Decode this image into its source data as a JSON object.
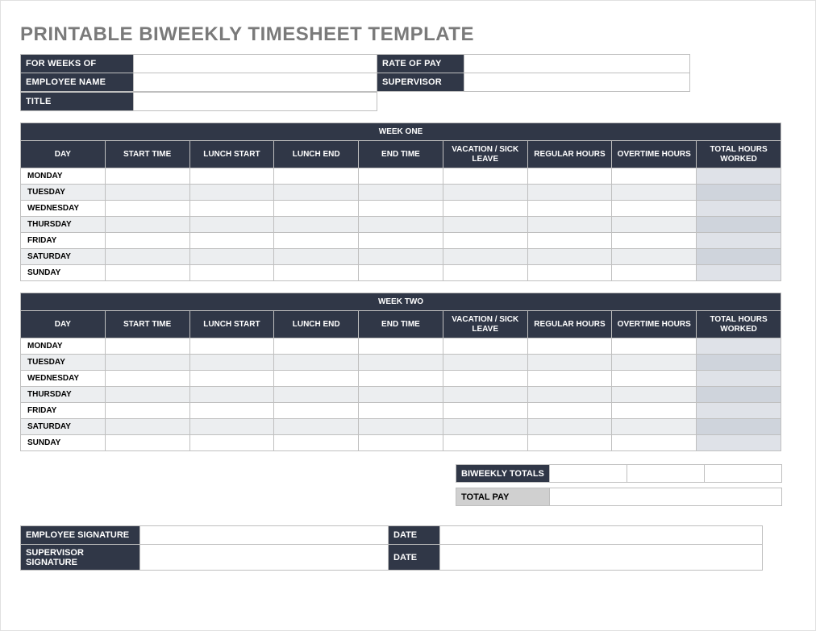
{
  "title": "PRINTABLE BIWEEKLY TIMESHEET TEMPLATE",
  "info": {
    "for_weeks_of_label": "FOR WEEKS OF",
    "for_weeks_of_value": "",
    "rate_of_pay_label": "RATE OF PAY",
    "rate_of_pay_value": "",
    "employee_name_label": "EMPLOYEE NAME",
    "employee_name_value": "",
    "supervisor_label": "SUPERVISOR",
    "supervisor_value": "",
    "title_label": "TITLE",
    "title_value": ""
  },
  "columns": {
    "day": "DAY",
    "start": "START TIME",
    "lunch_start": "LUNCH START",
    "lunch_end": "LUNCH END",
    "end": "END TIME",
    "vacation": "VACATION / SICK LEAVE",
    "regular": "REGULAR HOURS",
    "overtime": "OVERTIME HOURS",
    "total": "TOTAL HOURS WORKED"
  },
  "week1": {
    "title": "WEEK ONE",
    "days": [
      "MONDAY",
      "TUESDAY",
      "WEDNESDAY",
      "THURSDAY",
      "FRIDAY",
      "SATURDAY",
      "SUNDAY"
    ]
  },
  "week2": {
    "title": "WEEK TWO",
    "days": [
      "MONDAY",
      "TUESDAY",
      "WEDNESDAY",
      "THURSDAY",
      "FRIDAY",
      "SATURDAY",
      "SUNDAY"
    ]
  },
  "totals": {
    "biweekly_label": "BIWEEKLY TOTALS",
    "biweekly_reg": "",
    "biweekly_ot": "",
    "biweekly_total": "",
    "totalpay_label": "TOTAL PAY",
    "totalpay_value": ""
  },
  "signatures": {
    "employee_label": "EMPLOYEE SIGNATURE",
    "employee_value": "",
    "supervisor_label": "SUPERVISOR SIGNATURE",
    "supervisor_value": "",
    "date_label": "DATE",
    "date1_value": "",
    "date2_value": ""
  }
}
